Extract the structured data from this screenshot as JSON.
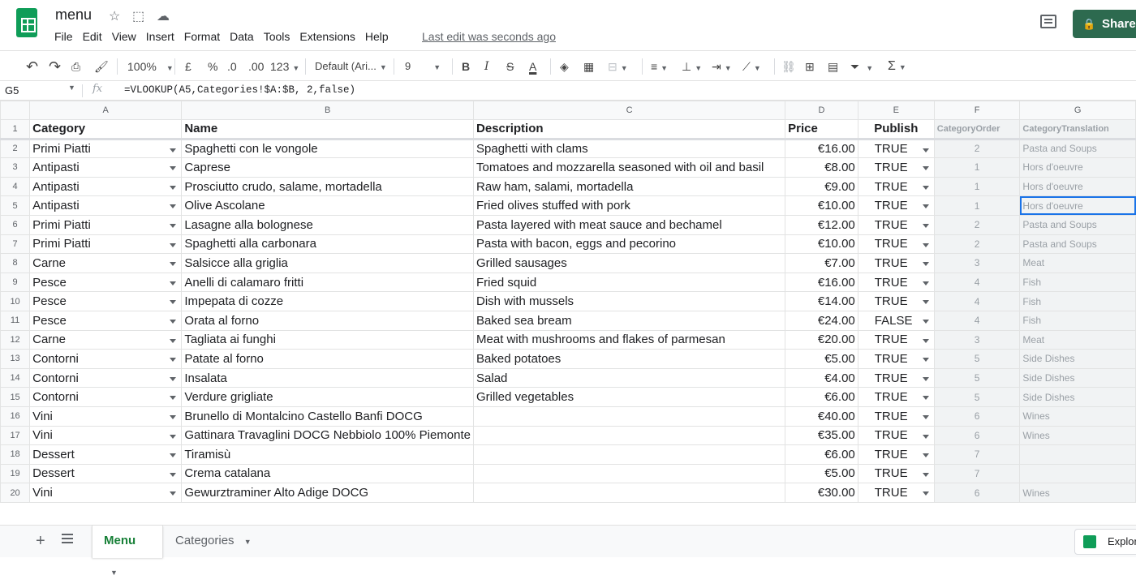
{
  "app": {
    "doc_title": "menu",
    "menu_items": [
      "File",
      "Edit",
      "View",
      "Insert",
      "Format",
      "Data",
      "Tools",
      "Extensions",
      "Help"
    ],
    "last_edit": "Last edit was seconds ago",
    "share_label": "Share"
  },
  "toolbar": {
    "zoom": "100%",
    "currency": "£",
    "percent": "%",
    "dec_decrease": ".0",
    "dec_increase": ".00",
    "more_formats": "123",
    "font_family": "Default (Ari...",
    "font_size": "9",
    "bold": "B",
    "italic": "I",
    "strike": "S",
    "text_color": "A",
    "sum": "Σ"
  },
  "formula_bar": {
    "cell_ref": "G5",
    "fx": "fx",
    "formula": "=VLOOKUP(A5,Categories!$A:$B, 2,false)"
  },
  "columns": [
    "A",
    "B",
    "C",
    "D",
    "E",
    "F",
    "G"
  ],
  "header": {
    "row_number": "1",
    "cells": [
      "Category",
      "Name",
      "Description",
      "Price",
      "Publish",
      "CategoryOrder",
      "CategoryTranslation"
    ]
  },
  "rows": [
    {
      "n": "2",
      "category": "Primi Piatti",
      "name": "Spaghetti con le vongole",
      "description": "Spaghetti with clams",
      "price": "€16.00",
      "publish": "TRUE",
      "order": "2",
      "translation": "Pasta and Soups"
    },
    {
      "n": "3",
      "category": "Antipasti",
      "name": "Caprese",
      "description": "Tomatoes and mozzarella seasoned with oil and basil",
      "price": "€8.00",
      "publish": "TRUE",
      "order": "1",
      "translation": "Hors d'oeuvre"
    },
    {
      "n": "4",
      "category": "Antipasti",
      "name": "Prosciutto crudo, salame, mortadella",
      "description": "Raw ham, salami, mortadella",
      "price": "€9.00",
      "publish": "TRUE",
      "order": "1",
      "translation": "Hors d'oeuvre"
    },
    {
      "n": "5",
      "category": "Antipasti",
      "name": "Olive Ascolane",
      "description": "Fried olives stuffed with pork",
      "price": "€10.00",
      "publish": "TRUE",
      "order": "1",
      "translation": "Hors d'oeuvre"
    },
    {
      "n": "6",
      "category": "Primi Piatti",
      "name": "Lasagne alla bolognese",
      "description": "Pasta layered with meat sauce and bechamel",
      "price": "€12.00",
      "publish": "TRUE",
      "order": "2",
      "translation": "Pasta and Soups"
    },
    {
      "n": "7",
      "category": "Primi Piatti",
      "name": "Spaghetti alla carbonara",
      "description": "Pasta with bacon, eggs and pecorino",
      "price": "€10.00",
      "publish": "TRUE",
      "order": "2",
      "translation": "Pasta and Soups"
    },
    {
      "n": "8",
      "category": "Carne",
      "name": "Salsicce alla griglia",
      "description": "Grilled sausages",
      "price": "€7.00",
      "publish": "TRUE",
      "order": "3",
      "translation": "Meat"
    },
    {
      "n": "9",
      "category": "Pesce",
      "name": "Anelli di calamaro fritti",
      "description": "Fried squid",
      "price": "€16.00",
      "publish": "TRUE",
      "order": "4",
      "translation": "Fish"
    },
    {
      "n": "10",
      "category": "Pesce",
      "name": "Impepata di cozze",
      "description": "Dish with mussels",
      "price": "€14.00",
      "publish": "TRUE",
      "order": "4",
      "translation": "Fish"
    },
    {
      "n": "11",
      "category": "Pesce",
      "name": "Orata al forno",
      "description": "Baked sea bream",
      "price": "€24.00",
      "publish": "FALSE",
      "order": "4",
      "translation": "Fish"
    },
    {
      "n": "12",
      "category": "Carne",
      "name": "Tagliata ai funghi",
      "description": "Meat with mushrooms and  flakes of parmesan",
      "price": "€20.00",
      "publish": "TRUE",
      "order": "3",
      "translation": "Meat"
    },
    {
      "n": "13",
      "category": "Contorni",
      "name": "Patate al forno",
      "description": "Baked potatoes",
      "price": "€5.00",
      "publish": "TRUE",
      "order": "5",
      "translation": "Side Dishes"
    },
    {
      "n": "14",
      "category": "Contorni",
      "name": "Insalata",
      "description": "Salad",
      "price": "€4.00",
      "publish": "TRUE",
      "order": "5",
      "translation": "Side Dishes"
    },
    {
      "n": "15",
      "category": "Contorni",
      "name": "Verdure grigliate",
      "description": "Grilled vegetables",
      "price": "€6.00",
      "publish": "TRUE",
      "order": "5",
      "translation": "Side Dishes"
    },
    {
      "n": "16",
      "category": "Vini",
      "name": "Brunello di Montalcino Castello Banfi DOCG",
      "description": "",
      "price": "€40.00",
      "publish": "TRUE",
      "order": "6",
      "translation": "Wines"
    },
    {
      "n": "17",
      "category": "Vini",
      "name": "Gattinara Travaglini DOCG Nebbiolo 100% Piemonte",
      "description": "",
      "price": "€35.00",
      "publish": "TRUE",
      "order": "6",
      "translation": "Wines"
    },
    {
      "n": "18",
      "category": "Dessert",
      "name": "Tiramisù",
      "description": "",
      "price": "€6.00",
      "publish": "TRUE",
      "order": "7",
      "translation": ""
    },
    {
      "n": "19",
      "category": "Dessert",
      "name": "Crema catalana",
      "description": "",
      "price": "€5.00",
      "publish": "TRUE",
      "order": "7",
      "translation": ""
    },
    {
      "n": "20",
      "category": "Vini",
      "name": "Gewurztraminer Alto Adige DOCG",
      "description": "",
      "price": "€30.00",
      "publish": "TRUE",
      "order": "6",
      "translation": "Wines"
    }
  ],
  "selected_cell": {
    "row": "5",
    "col": "G"
  },
  "sheet_tabs": [
    "Menu",
    "Categories"
  ],
  "active_tab": "Menu",
  "explore_label": "Explore",
  "colors": {
    "brand_green": "#0f9d58",
    "share_bg": "#2d6a4f",
    "selection": "#1a73e8",
    "active_tab_text": "#188038"
  }
}
